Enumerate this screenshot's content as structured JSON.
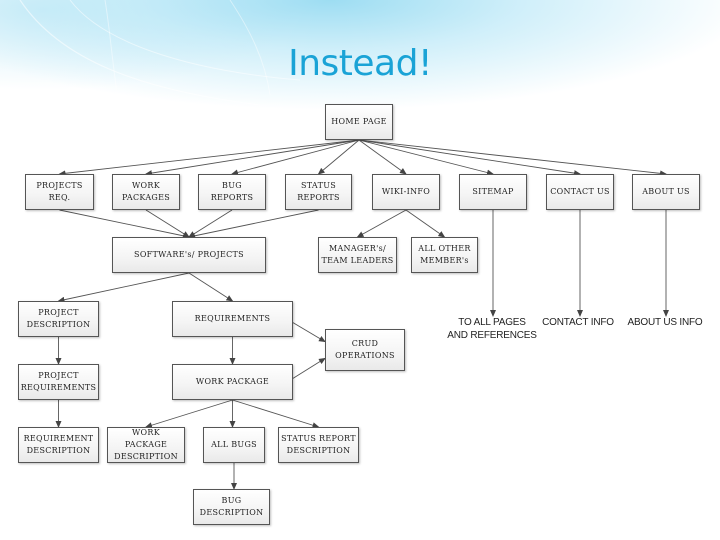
{
  "slide": {
    "title": "Instead!",
    "accent_color": "#1aa3d6"
  },
  "diagram": {
    "nodes": {
      "home_page": "HOME PAGE",
      "projects_req": "PROJECTS\nREQ.",
      "work_packages": "WORK\nPACKAGES",
      "bug_reports": "BUG\nREPORTS",
      "status_reports": "STATUS\nREPORTS",
      "wiki_info": "WIKI-INFO",
      "sitemap": "SITEMAP",
      "contact_us": "CONTACT US",
      "about_us": "ABOUT US",
      "softwares_projects": "SOFTWARE's/ PROJECTS",
      "managers_team_leaders": "MANAGER's/\nTEAM LEADERS",
      "all_other_members": "ALL OTHER\nMEMBER's",
      "project_description": "PROJECT\nDESCRIPTION",
      "requirements": "REQUIREMENTS",
      "crud_operations": "CRUD\nOPERATIONS",
      "project_requirements": "PROJECT\nREQUIREMENTS",
      "work_package": "WORK PACKAGE",
      "requirement_description": "REQUIREMENT\nDESCRIPTION",
      "work_package_description": "WORK PACKAGE\nDESCRIPTION",
      "all_bugs": "ALL BUGS",
      "status_report_description": "STATUS REPORT\nDESCRIPTION",
      "bug_description": "BUG\nDESCRIPTION"
    },
    "labels": {
      "to_all_pages": "TO ALL PAGES\nAND REFERENCES",
      "contact_info": "CONTACT INFO",
      "about_us_info": "ABOUT US INFO"
    },
    "edges": [
      [
        "home_page",
        "projects_req"
      ],
      [
        "home_page",
        "work_packages"
      ],
      [
        "home_page",
        "bug_reports"
      ],
      [
        "home_page",
        "status_reports"
      ],
      [
        "home_page",
        "wiki_info"
      ],
      [
        "home_page",
        "sitemap"
      ],
      [
        "home_page",
        "contact_us"
      ],
      [
        "home_page",
        "about_us"
      ],
      [
        "projects_req",
        "softwares_projects"
      ],
      [
        "work_packages",
        "softwares_projects"
      ],
      [
        "bug_reports",
        "softwares_projects"
      ],
      [
        "status_reports",
        "softwares_projects"
      ],
      [
        "wiki_info",
        "managers_team_leaders"
      ],
      [
        "wiki_info",
        "all_other_members"
      ],
      [
        "sitemap",
        "to_all_pages"
      ],
      [
        "contact_us",
        "contact_info"
      ],
      [
        "about_us",
        "about_us_info"
      ],
      [
        "softwares_projects",
        "project_description"
      ],
      [
        "softwares_projects",
        "requirements"
      ],
      [
        "project_description",
        "project_requirements"
      ],
      [
        "requirements",
        "work_package"
      ],
      [
        "requirements",
        "crud_operations"
      ],
      [
        "work_package",
        "crud_operations"
      ],
      [
        "project_requirements",
        "requirement_description"
      ],
      [
        "work_package",
        "work_package_description"
      ],
      [
        "work_package",
        "all_bugs"
      ],
      [
        "work_package",
        "status_report_description"
      ],
      [
        "all_bugs",
        "bug_description"
      ]
    ]
  }
}
